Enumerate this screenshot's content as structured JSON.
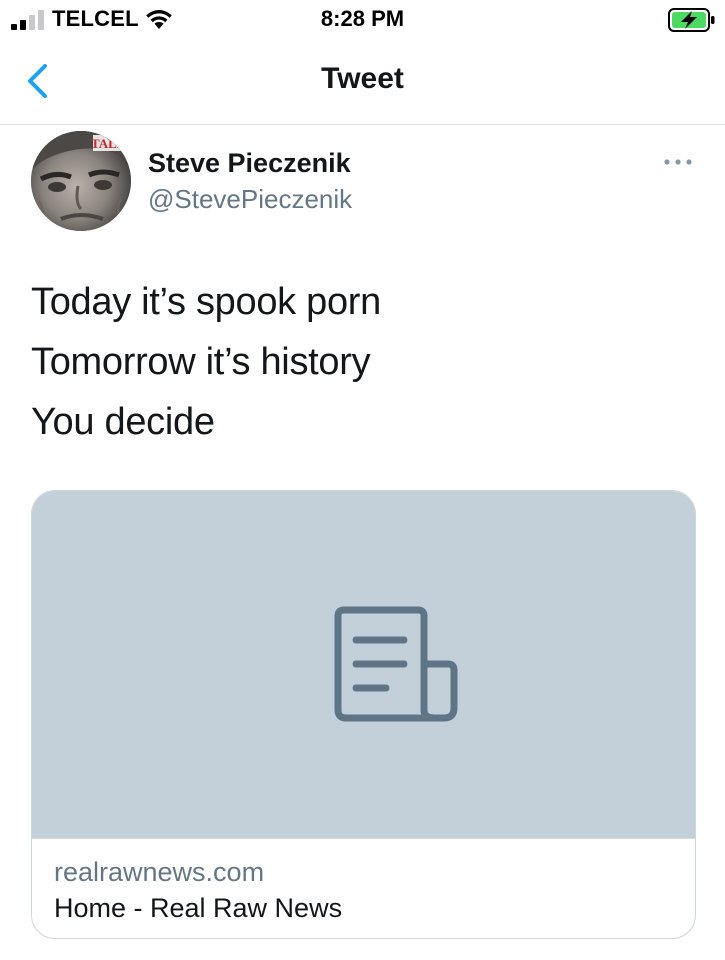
{
  "status_bar": {
    "carrier": "TELCEL",
    "time": "8:28 PM",
    "signal_bars_filled": 2,
    "signal_bars_total": 4,
    "battery_state": "charging",
    "battery_color": "#4cd964"
  },
  "nav": {
    "back_icon": "chevron-left-icon",
    "title": "Tweet",
    "accent_color": "#1da1f2"
  },
  "tweet": {
    "author": {
      "name": "Steve Pieczenik",
      "handle": "@StevePieczenik",
      "avatar_badge_text": "TALK"
    },
    "more_icon": "ellipsis-icon",
    "lines": [
      "Today it’s spook porn",
      "Tomorrow it’s history",
      "You decide"
    ]
  },
  "link_card": {
    "placeholder_icon": "article-icon",
    "domain": "realrawnews.com",
    "title": "Home - Real Raw News"
  }
}
